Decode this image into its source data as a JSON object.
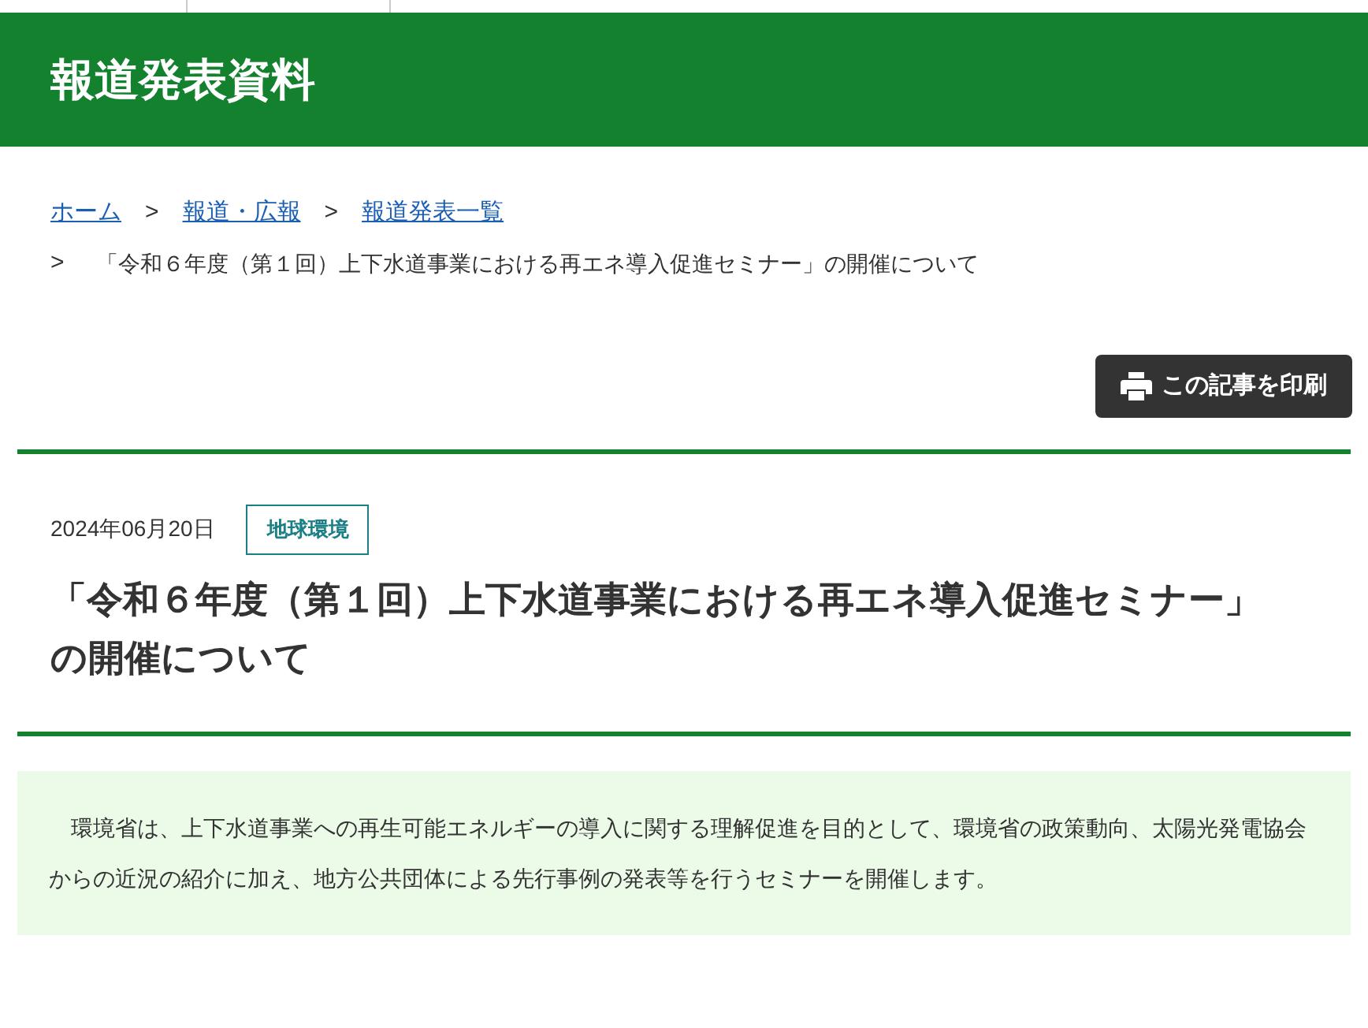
{
  "header": {
    "title": "報道発表資料"
  },
  "breadcrumb": {
    "links": [
      "ホーム",
      "報道・広報",
      "報道発表一覧"
    ],
    "separators": [
      ">",
      ">",
      ">"
    ],
    "current": "「令和６年度（第１回）上下水道事業における再エネ導入促進セミナー」の開催について"
  },
  "print_button": {
    "label": "この記事を印刷"
  },
  "article": {
    "date": "2024年06月20日",
    "tag": "地球環境",
    "title": "「令和６年度（第１回）上下水道事業における再エネ導入促進セミナー」の開催について",
    "summary": "環境省は、上下水道事業への再生可能エネルギーの導入に関する理解促進を目的として、環境省の政策動向、太陽光発電協会からの近況の紹介に加え、地方公共団体による先行事例の発表等を行うセミナーを開催します。"
  }
}
